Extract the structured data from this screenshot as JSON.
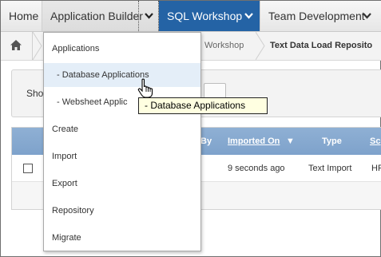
{
  "topnav": {
    "home": "Home",
    "app_builder": "Application Builder",
    "sql_workshop": "SQL Workshop",
    "team_development": "Team Development",
    "active_color": "#2463a5"
  },
  "breadcrumb": {
    "home_icon": "home-icon",
    "workshop": "Workshop",
    "current": "Text Data Load Reposito"
  },
  "panel": {
    "label": "Sho"
  },
  "grid": {
    "headers": {
      "by": "By",
      "imported_on": "Imported On",
      "type": "Type",
      "schema": "Sc"
    },
    "row": {
      "imported_on": "9 seconds ago",
      "type": "Text Import",
      "schema": "HF"
    }
  },
  "menu": {
    "items": [
      "Applications",
      "- Database Applications",
      "- Websheet Applic",
      "Create",
      "Import",
      "Export",
      "Repository",
      "Migrate"
    ],
    "hover_color": "#e4eef8"
  },
  "tooltip": "- Database Applications"
}
